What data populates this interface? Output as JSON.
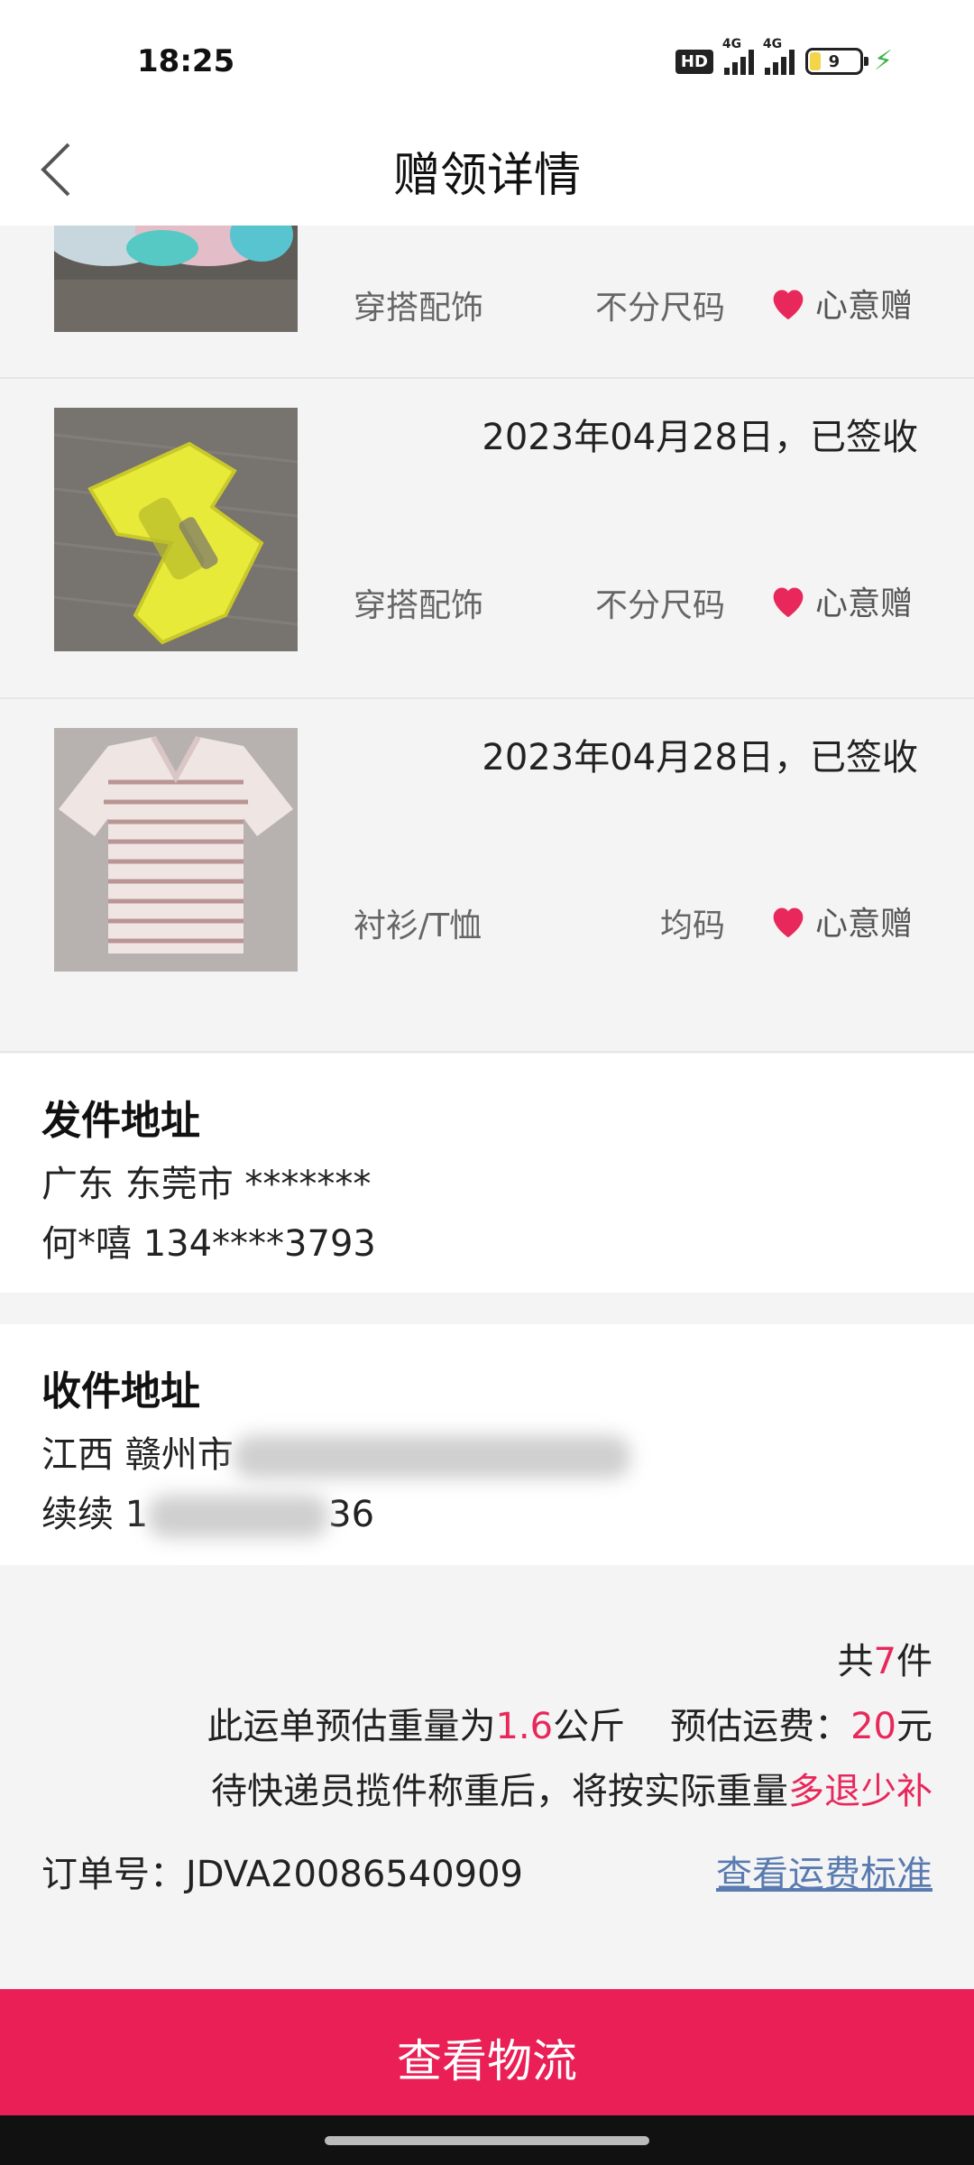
{
  "status": {
    "time": "18:25",
    "hd": "HD",
    "sim1": "4G",
    "sim2": "4G",
    "battery": "9"
  },
  "header": {
    "title": "赠领详情"
  },
  "items": [
    {
      "date": "",
      "category": "穿搭配饰",
      "size": "不分尺码",
      "gift_label": "心意赠"
    },
    {
      "date": "2023年04月28日，已签收",
      "category": "穿搭配饰",
      "size": "不分尺码",
      "gift_label": "心意赠"
    },
    {
      "date": "2023年04月28日，已签收",
      "category": "衬衫/T恤",
      "size": "均码",
      "gift_label": "心意赠"
    }
  ],
  "sender": {
    "title": "发件地址",
    "address": "广东 东莞市 *******",
    "contact": "何*嘻 134****3793"
  },
  "receiver": {
    "title": "收件地址",
    "address_visible": "江西 赣州市",
    "contact_prefix": "续续 1",
    "contact_suffix": "36"
  },
  "summary": {
    "count_prefix": "共",
    "count": "7",
    "count_suffix": "件",
    "weight_prefix": "此运单预估重量为",
    "weight": "1.6",
    "weight_unit": "公斤",
    "fee_prefix": "预估运费：",
    "fee": "20",
    "fee_unit": "元",
    "note_prefix": "待快递员揽件称重后，将按实际重量",
    "note_highlight": "多退少补",
    "order_label": "订单号：",
    "order_no": "JDVA20086540909",
    "fee_link": "查看运费标准"
  },
  "cta": {
    "label": "查看物流"
  },
  "colors": {
    "accent": "#ea1f55",
    "link": "#5a7bb0",
    "heart": "#e8285b"
  }
}
